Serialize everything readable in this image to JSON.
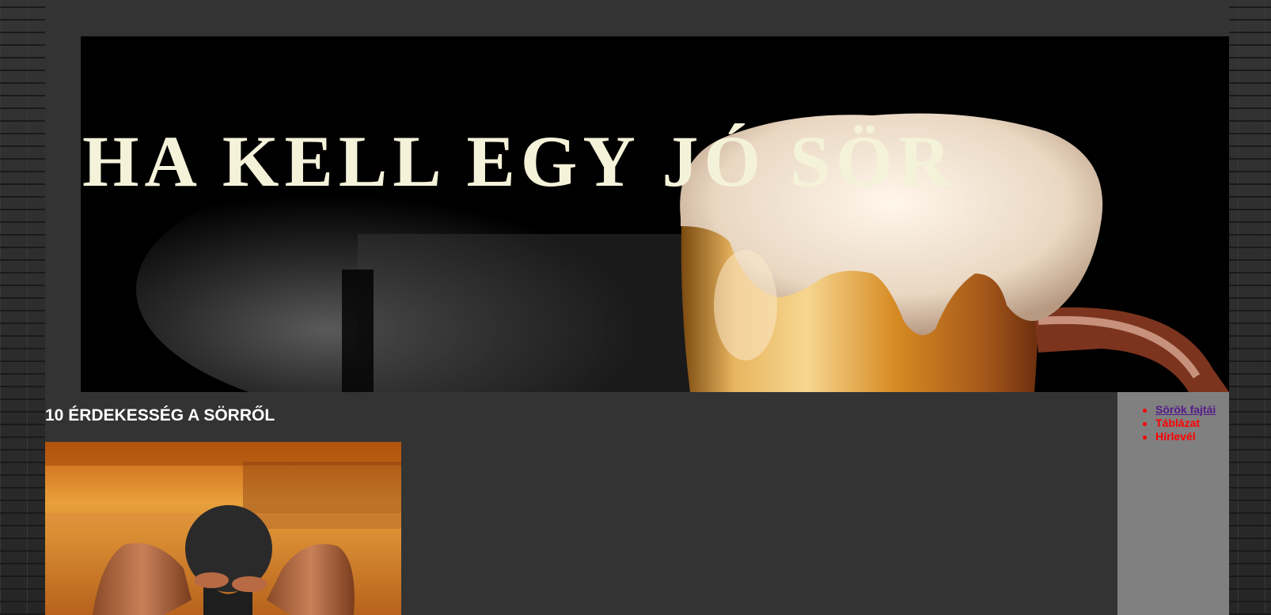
{
  "header": {
    "title": "HA KELL EGY JÓ SÖR"
  },
  "main": {
    "heading": "10 ÉRDEKESSÉG A SÖRRŐL"
  },
  "sidebar": {
    "items": [
      {
        "label": "Sörök fajtái",
        "visited": true
      },
      {
        "label": "Táblázat",
        "visited": false
      },
      {
        "label": "Hírlevél",
        "visited": false
      }
    ]
  },
  "colors": {
    "page_background": "#333333",
    "sidebar_background": "#808080",
    "link": "#ff0000",
    "visited_link": "#551a8b",
    "title_text": "#f5f2da"
  }
}
